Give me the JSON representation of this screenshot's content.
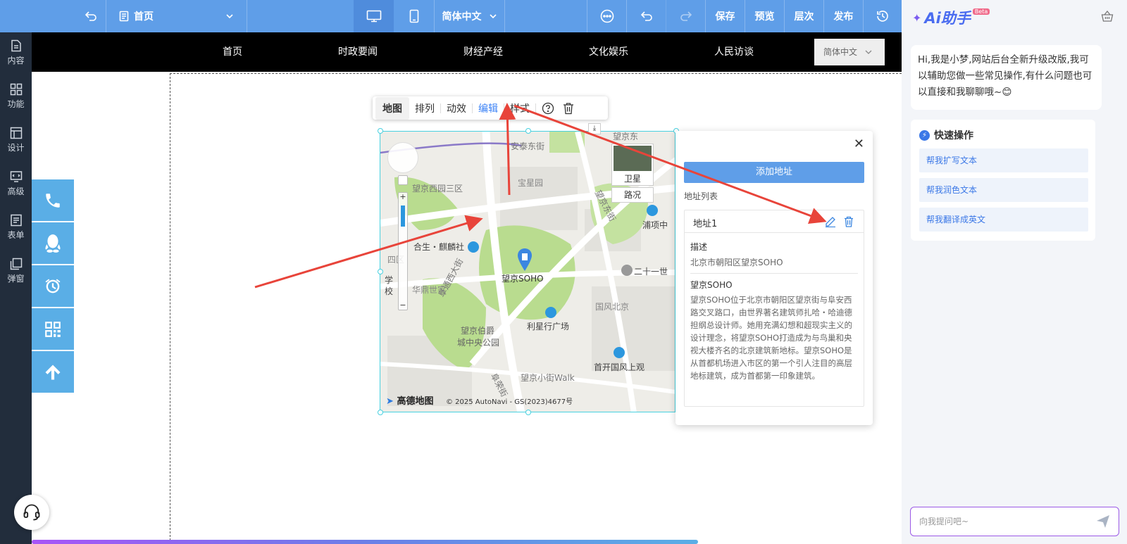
{
  "topbar": {
    "page_select": "首页",
    "lang_select": "简体中文",
    "save": "保存",
    "preview": "预览",
    "layers": "层次",
    "publish": "发布"
  },
  "leftbar": [
    "内容",
    "功能",
    "设计",
    "高级",
    "表单",
    "弹窗"
  ],
  "nav": {
    "items": [
      "首页",
      "时政要闻",
      "财经产经",
      "文化娱乐",
      "人民访谈"
    ],
    "lang": "简体中文"
  },
  "widget_toolbar": [
    "地图",
    "排列",
    "动效",
    "编辑",
    "样式"
  ],
  "map": {
    "labels": {
      "road1": "安泰东街",
      "poi_top": "望京东",
      "park1": "望京西园三区",
      "baoxing": "宝星园",
      "hesheng": "合生・麒麟社",
      "soho": "望京SOHO",
      "huading": "华鼎世家",
      "road2": "阜通西大街",
      "park2": "望京伯爵",
      "park2b": "城中央公园",
      "lixing": "利星行广场",
      "guofeng": "国风北京",
      "shoukai": "首开国风上观",
      "xiaojie": "望京小街Walk",
      "puxiang": "浦项中",
      "ershiyi": "二十一世",
      "siqu": "四区",
      "xue": "学",
      "xiao": "校",
      "road3": "望京东街",
      "road4": "阜荣街"
    },
    "satellite": "卫星",
    "traffic": "路况",
    "logo": "高德地图",
    "copyright": "© 2025 AutoNavi - GS(2023)4677号"
  },
  "panel": {
    "add_button": "添加地址",
    "list_label": "地址列表",
    "address_name": "地址1",
    "desc_label": "描述",
    "desc_value": "北京市朝阳区望京SOHO",
    "title": "望京SOHO",
    "body": "望京SOHO位于北京市朝阳区望京街与阜安西路交叉路口，由世界著名建筑师扎哈・哈迪德担纲总设计师。她用充满幻想和超现实主义的设计理念，将望京SOHO打造成为与鸟巢和央视大楼齐名的北京建筑新地标。望京SOHO是从首都机场进入市区的第一个引人注目的高层地标建筑，成为首都第一印象建筑。"
  },
  "ai": {
    "title": "Ai助手",
    "badge": "Beta",
    "greeting": "Hi,我是小梦,网站后台全新升级改版,我可以辅助您做一些常见操作,有什么问题也可以直接和我聊聊哦~",
    "quick_title": "快速操作",
    "quick_items": [
      "帮我扩写文本",
      "帮我润色文本",
      "帮我翻译成英文"
    ],
    "input_placeholder": "向我提问吧~"
  }
}
